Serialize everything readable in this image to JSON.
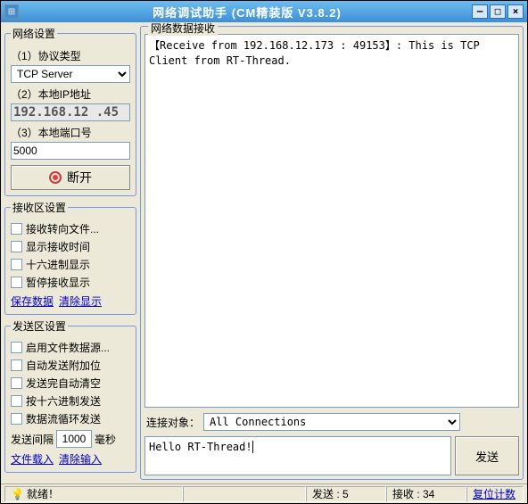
{
  "window": {
    "title": "网络调试助手  (CM精装版 V3.8.2)"
  },
  "net_settings": {
    "legend": "网络设置",
    "protocol_label": "（1）协议类型",
    "protocol_value": "   TCP Server",
    "ip_label": "（2）本地IP地址",
    "ip_value": "192.168.12 .45",
    "port_label": "（3）本地端口号",
    "port_value": "5000",
    "disconnect_btn": "断开"
  },
  "recv_settings": {
    "legend": "接收区设置",
    "opts": [
      "接收转向文件...",
      "显示接收时间",
      "十六进制显示",
      "暂停接收显示"
    ],
    "link_save": "保存数据",
    "link_clear": "清除显示"
  },
  "send_settings": {
    "legend": "发送区设置",
    "opts": [
      "启用文件数据源...",
      "自动发送附加位",
      "发送完自动清空",
      "按十六进制发送",
      "数据流循环发送"
    ],
    "interval_label": "发送间隔",
    "interval_value": "1000",
    "interval_unit": "毫秒",
    "link_load": "文件载入",
    "link_clear": "清除输入"
  },
  "recv_area": {
    "legend": "网络数据接收",
    "text": "【Receive from 192.168.12.173 : 49153】: This is TCP Client from RT-Thread."
  },
  "conn": {
    "label": "连接对象：",
    "value": "All Connections"
  },
  "send": {
    "text": "Hello RT-Thread!",
    "btn": "发送"
  },
  "status": {
    "ready": "就绪！",
    "send": "发送 : 5",
    "recv": "接收 : 34",
    "reset": "复位计数"
  }
}
